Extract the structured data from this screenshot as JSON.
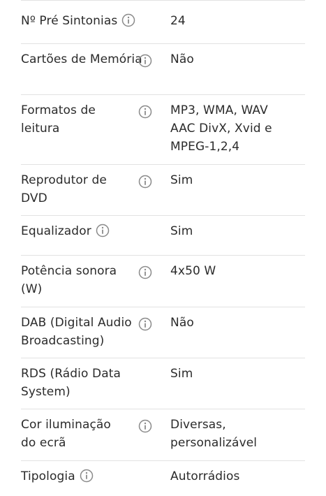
{
  "specs": [
    {
      "label": "Nº Pré Sintonias",
      "value": "24",
      "info_icon": "info-icon"
    },
    {
      "label": "Cartões de Memória",
      "value": "Não",
      "info_icon": "info-icon"
    },
    {
      "label": "Formatos de leitura",
      "value": "MP3, WMA, WAV AAC DivX, Xvid e MPEG-1,2,4",
      "info_icon": "info-icon"
    },
    {
      "label": "Reprodutor de DVD",
      "value": "Sim",
      "info_icon": "info-icon"
    },
    {
      "label": "Equalizador",
      "value": "Sim",
      "info_icon": "info-icon"
    },
    {
      "label": "Potência sonora (W)",
      "value": "4x50 W",
      "info_icon": "info-icon"
    },
    {
      "label": "DAB (Digital Audio Broadcasting)",
      "value": "Não",
      "info_icon": "info-icon"
    },
    {
      "label": "RDS (Rádio Data System)",
      "value": "Sim",
      "info_icon": null
    },
    {
      "label": "Cor iluminação do ecrã",
      "value": "Diversas, personalizável",
      "info_icon": "info-icon"
    },
    {
      "label": "Tipologia",
      "value": "Autorrádios",
      "info_icon": "info-icon"
    }
  ],
  "colors": {
    "text": "#2b2b2b",
    "icon": "#8a8a8a",
    "divider": "#e2e2e2"
  }
}
